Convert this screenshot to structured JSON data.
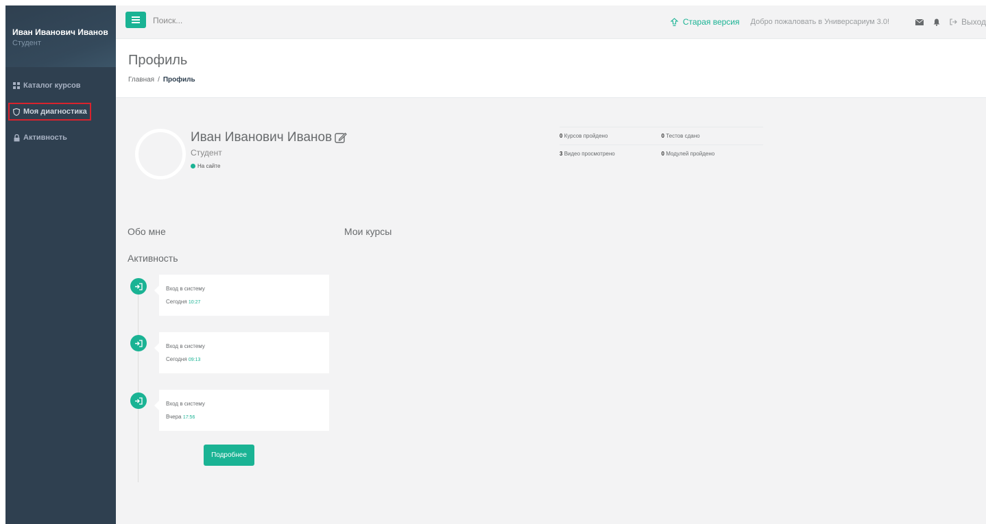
{
  "sidebar": {
    "user_name": "Иван Иванович Иванов",
    "user_role": "Студент",
    "items": [
      {
        "label": "Каталог курсов",
        "icon": "grid-icon"
      },
      {
        "label": "Моя диагностика",
        "icon": "shield-icon"
      },
      {
        "label": "Активность",
        "icon": "lock-icon"
      }
    ],
    "highlight_color": "#d9232d"
  },
  "topbar": {
    "search_placeholder": "Поиск...",
    "old_version": "Старая версия",
    "welcome": "Добро пожаловать в Универсариум 3.0!",
    "logout": "Выход"
  },
  "page": {
    "title": "Профиль",
    "breadcrumb": {
      "home": "Главная",
      "separator": "/",
      "current": "Профиль"
    }
  },
  "profile": {
    "name": "Иван Иванович Иванов",
    "role": "Студент",
    "status": "На сайте",
    "stats": [
      {
        "count": "0",
        "label": "Курсов пройдено"
      },
      {
        "count": "0",
        "label": "Тестов сдано"
      },
      {
        "count": "3",
        "label": "Видео просмотрено"
      },
      {
        "count": "0",
        "label": "Модулей пройдено"
      }
    ]
  },
  "sections": {
    "about": "Обо мне",
    "courses": "Мои курсы",
    "activity": "Активность"
  },
  "activity": [
    {
      "text": "Вход в систему",
      "day": "Сегодня",
      "time": "10:27"
    },
    {
      "text": "Вход в систему",
      "day": "Сегодня",
      "time": "09:13"
    },
    {
      "text": "Вход в систему",
      "day": "Вчера",
      "time": "17:56"
    }
  ],
  "more_button": "Подробнее",
  "colors": {
    "accent": "#1ab394",
    "sidebar": "#2f4050",
    "background": "#f3f3f4"
  }
}
